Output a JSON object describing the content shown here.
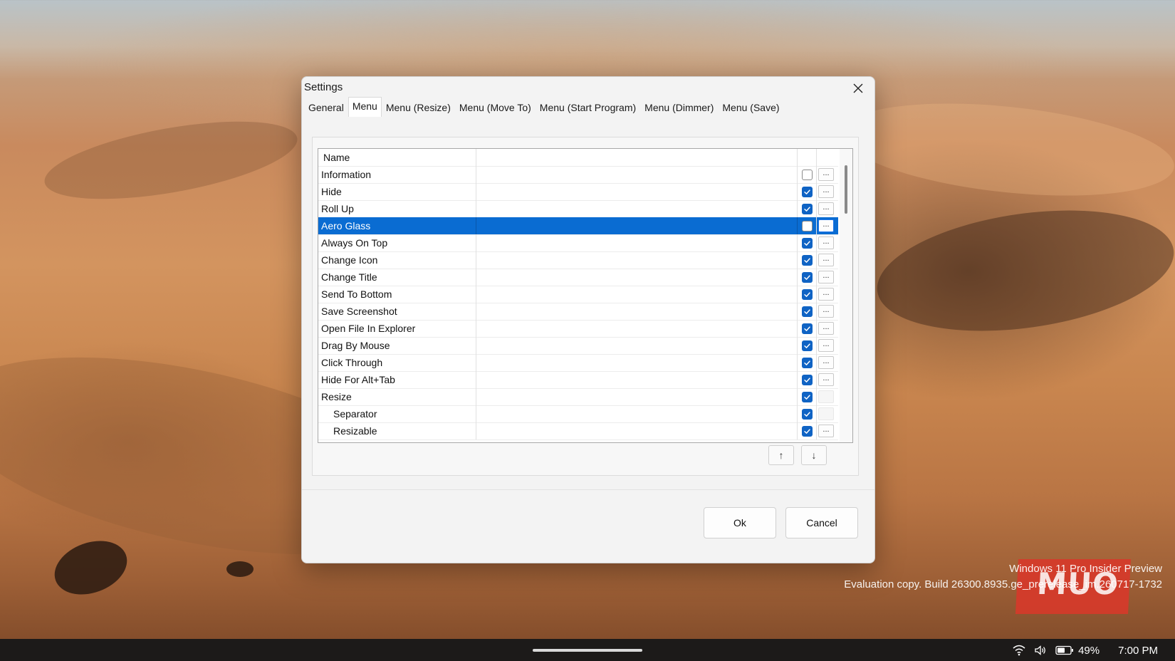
{
  "dialog": {
    "title": "Settings",
    "tabs": [
      {
        "label": "General"
      },
      {
        "label": "Menu"
      },
      {
        "label": "Menu (Resize)"
      },
      {
        "label": "Menu (Move To)"
      },
      {
        "label": "Menu (Start Program)"
      },
      {
        "label": "Menu (Dimmer)"
      },
      {
        "label": "Menu (Save)"
      }
    ],
    "active_tab": "Menu",
    "grid": {
      "header_name": "Name",
      "rows": [
        {
          "name": "Information",
          "checked": false,
          "dots": "..."
        },
        {
          "name": "Hide",
          "checked": true,
          "dots": "..."
        },
        {
          "name": "Roll Up",
          "checked": true,
          "dots": "..."
        },
        {
          "name": "Aero Glass",
          "checked": false,
          "dots": "...",
          "selected": true
        },
        {
          "name": "Always On Top",
          "checked": true,
          "dots": "..."
        },
        {
          "name": "Change Icon",
          "checked": true,
          "dots": "..."
        },
        {
          "name": "Change Title",
          "checked": true,
          "dots": "..."
        },
        {
          "name": "Send To Bottom",
          "checked": true,
          "dots": "..."
        },
        {
          "name": "Save Screenshot",
          "checked": true,
          "dots": "..."
        },
        {
          "name": "Open File In Explorer",
          "checked": true,
          "dots": "..."
        },
        {
          "name": "Drag By Mouse",
          "checked": true,
          "dots": "..."
        },
        {
          "name": "Click Through",
          "checked": true,
          "dots": "..."
        },
        {
          "name": "Hide For Alt+Tab",
          "checked": true,
          "dots": "..."
        },
        {
          "name": "Resize",
          "checked": true,
          "dots": ""
        },
        {
          "name": "Separator",
          "checked": true,
          "dots": "",
          "indent": true
        },
        {
          "name": "Resizable",
          "checked": true,
          "dots": "...",
          "indent": true
        }
      ]
    },
    "move_up": "↑",
    "move_down": "↓",
    "ok_label": "Ok",
    "cancel_label": "Cancel"
  },
  "watermark": {
    "line1": "Windows 11 Pro Insider Preview",
    "line2": "Evaluation copy. Build 26300.8935.ge_prerelease_im.260717-1732",
    "logo_text": "MUO"
  },
  "taskbar": {
    "battery": "49%",
    "time": "7:00 PM",
    "icons": [
      "wifi-icon",
      "volume-icon",
      "battery-icon"
    ]
  },
  "colors": {
    "accent": "#0a6cd2",
    "checkbox": "#0f63c4",
    "logo": "#d63a2a"
  }
}
